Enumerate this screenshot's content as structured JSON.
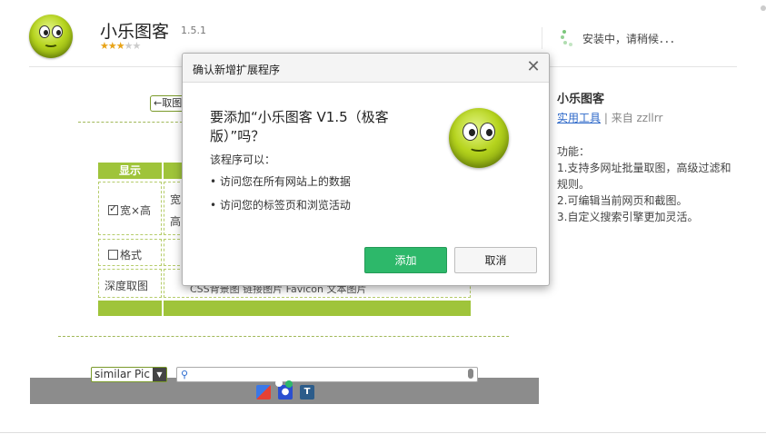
{
  "app": {
    "title": "小乐图客",
    "version": "1.5.1",
    "rating": 3,
    "rating_max": 5
  },
  "install_status": "安装中，请稍候．．．",
  "info": {
    "name": "小乐图客",
    "category_link": "实用工具",
    "category_sep": " | ",
    "author": "来自 zzllrr",
    "desc_title": "功能：",
    "desc_lines": [
      "1.支持多网址批量取图，高级过滤和规则。",
      "2.可编辑当前网页和截图。",
      "3.自定义搜索引擎更加灵活。"
    ]
  },
  "background": {
    "fetch_button": "←取图",
    "table_header": "显示",
    "row_width_height": "宽×高",
    "row_format": "格式",
    "row_deep_fetch": "深度取图",
    "col2_top": "宽",
    "col2_bottom": "高",
    "options_row": "CSS背景图  链接图片  Favicon  文本图片",
    "select_value": "similar Pic"
  },
  "dialog": {
    "title": "确认新增扩展程序",
    "heading": "要添加“小乐图客 V1.5（极客版）”吗？",
    "sub": "该程序可以：",
    "permissions": [
      "访问您在所有网站上的数据",
      "访问您的标签页和浏览活动"
    ],
    "add_label": "添加",
    "cancel_label": "取消"
  },
  "colors": {
    "accent_green": "#2db86a",
    "table_green": "#9fc43a",
    "link_blue": "#2a66c8"
  }
}
